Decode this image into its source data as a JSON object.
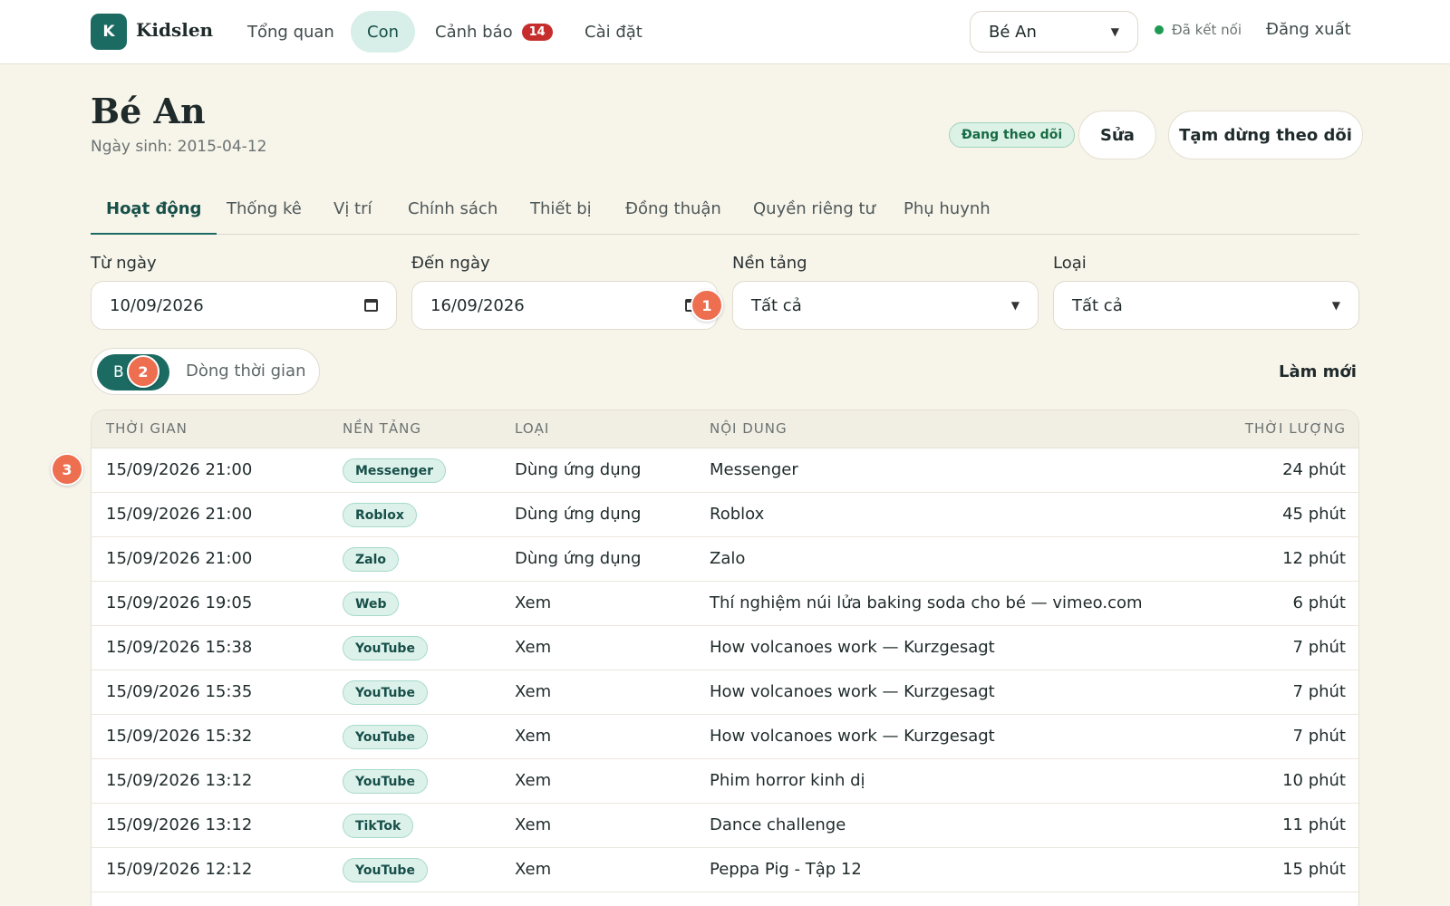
{
  "app": {
    "logo_letter": "K",
    "name": "Kidslen"
  },
  "nav": {
    "links": [
      {
        "label": "Tổng quan"
      },
      {
        "label": "Con"
      },
      {
        "label": "Cảnh báo",
        "badge": "14"
      },
      {
        "label": "Cài đặt"
      }
    ],
    "child_select": "Bé An",
    "connection": "Đã kết nối",
    "logout": "Đăng xuất"
  },
  "header": {
    "title": "Bé An",
    "birth": "Ngày sinh: 2015-04-12",
    "status": "Đang theo dõi",
    "edit": "Sửa",
    "pause": "Tạm dừng theo dõi"
  },
  "tabs": [
    "Hoạt động",
    "Thống kê",
    "Vị trí",
    "Chính sách",
    "Thiết bị",
    "Đồng thuận",
    "Quyền riêng tư",
    "Phụ huynh"
  ],
  "filters": {
    "from_label": "Từ ngày",
    "from_value": "10/09/2026",
    "to_label": "Đến ngày",
    "to_value": "16/09/2026",
    "platform_label": "Nền tảng",
    "platform_value": "Tất cả",
    "type_label": "Loại",
    "type_value": "Tất cả"
  },
  "markers": [
    "1",
    "2",
    "3"
  ],
  "view": {
    "on": "B",
    "off": "Dòng thời gian",
    "refresh": "Làm mới"
  },
  "table": {
    "headers": [
      "THỜI GIAN",
      "NỀN TẢNG",
      "LOẠI",
      "NỘI DUNG",
      "THỜI LƯỢNG"
    ],
    "rows": [
      {
        "time": "15/09/2026 21:00",
        "platform": "Messenger",
        "type": "Dùng ứng dụng",
        "content": "Messenger",
        "duration": "24 phút"
      },
      {
        "time": "15/09/2026 21:00",
        "platform": "Roblox",
        "type": "Dùng ứng dụng",
        "content": "Roblox",
        "duration": "45 phút"
      },
      {
        "time": "15/09/2026 21:00",
        "platform": "Zalo",
        "type": "Dùng ứng dụng",
        "content": "Zalo",
        "duration": "12 phút"
      },
      {
        "time": "15/09/2026 19:05",
        "platform": "Web",
        "type": "Xem",
        "content": "Thí nghiệm núi lửa baking soda cho bé — vimeo.com",
        "duration": "6 phút"
      },
      {
        "time": "15/09/2026 15:38",
        "platform": "YouTube",
        "type": "Xem",
        "content": "How volcanoes work — Kurzgesagt",
        "duration": "7 phút"
      },
      {
        "time": "15/09/2026 15:35",
        "platform": "YouTube",
        "type": "Xem",
        "content": "How volcanoes work — Kurzgesagt",
        "duration": "7 phút"
      },
      {
        "time": "15/09/2026 15:32",
        "platform": "YouTube",
        "type": "Xem",
        "content": "How volcanoes work — Kurzgesagt",
        "duration": "7 phút"
      },
      {
        "time": "15/09/2026 13:12",
        "platform": "YouTube",
        "type": "Xem",
        "content": "Phim horror kinh dị",
        "duration": "10 phút"
      },
      {
        "time": "15/09/2026 13:12",
        "platform": "TikTok",
        "type": "Xem",
        "content": "Dance challenge",
        "duration": "11 phút"
      },
      {
        "time": "15/09/2026 12:12",
        "platform": "YouTube",
        "type": "Xem",
        "content": "Peppa Pig - Tập 12",
        "duration": "15 phút"
      }
    ]
  }
}
